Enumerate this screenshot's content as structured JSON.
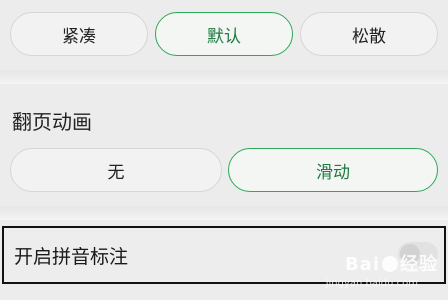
{
  "spacing": {
    "options": [
      {
        "label": "紧凑",
        "selected": false
      },
      {
        "label": "默认",
        "selected": true
      },
      {
        "label": "松散",
        "selected": false
      }
    ]
  },
  "page_turn": {
    "title": "翻页动画",
    "options": [
      {
        "label": "无",
        "selected": false
      },
      {
        "label": "滑动",
        "selected": true
      }
    ]
  },
  "pinyin": {
    "label": "开启拼音标注",
    "enabled": false
  },
  "watermark": {
    "brand_left": "Bai",
    "brand_right": "经验",
    "url": "jingyan.baidu.com"
  },
  "colors": {
    "accent": "#2fa85a",
    "background": "#ececec"
  }
}
